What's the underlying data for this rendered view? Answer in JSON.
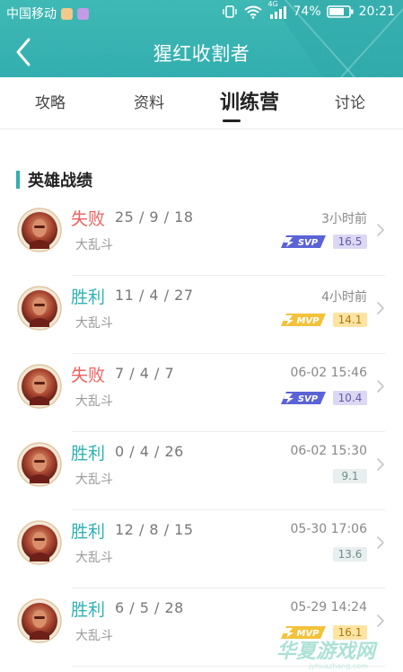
{
  "status_bar": {
    "carrier": "中国移动",
    "network": "4G",
    "battery": "74%",
    "time": "20:21"
  },
  "header": {
    "title": "猩红收割者"
  },
  "tabs": [
    {
      "label": "攻略",
      "active": false
    },
    {
      "label": "资料",
      "active": false
    },
    {
      "label": "训练营",
      "active": true
    },
    {
      "label": "讨论",
      "active": false
    }
  ],
  "section": {
    "title": "英雄战绩"
  },
  "records": [
    {
      "result": "失败",
      "outcome": "lose",
      "kda": "25 / 9 / 18",
      "mode": "大乱斗",
      "time": "3小时前",
      "badge": "SVP",
      "score": "16.5"
    },
    {
      "result": "胜利",
      "outcome": "win",
      "kda": "11 / 4 / 27",
      "mode": "大乱斗",
      "time": "4小时前",
      "badge": "MVP",
      "score": "14.1"
    },
    {
      "result": "失败",
      "outcome": "lose",
      "kda": "7 / 4 / 7",
      "mode": "大乱斗",
      "time": "06-02 15:46",
      "badge": "SVP",
      "score": "10.4"
    },
    {
      "result": "胜利",
      "outcome": "win",
      "kda": "0 / 4 / 26",
      "mode": "大乱斗",
      "time": "06-02 15:30",
      "badge": "",
      "score": "9.1"
    },
    {
      "result": "胜利",
      "outcome": "win",
      "kda": "12 / 8 / 15",
      "mode": "大乱斗",
      "time": "05-30 17:06",
      "badge": "",
      "score": "13.6"
    },
    {
      "result": "胜利",
      "outcome": "win",
      "kda": "6 / 5 / 28",
      "mode": "大乱斗",
      "time": "05-29 14:24",
      "badge": "MVP",
      "score": "16.1"
    }
  ],
  "colors": {
    "accent": "#33aeb0",
    "win": "#2fb1b4",
    "lose": "#f0615f",
    "svp": "#5b63d6",
    "mvp": "#f3c23a"
  },
  "icons": {
    "back": "back-arrow-icon",
    "chevron": "chevron-right-icon",
    "wifi": "wifi-icon",
    "signal": "signal-icon",
    "battery": "battery-icon",
    "vibrate": "vibrate-icon"
  },
  "watermark": "华夏游戏网"
}
